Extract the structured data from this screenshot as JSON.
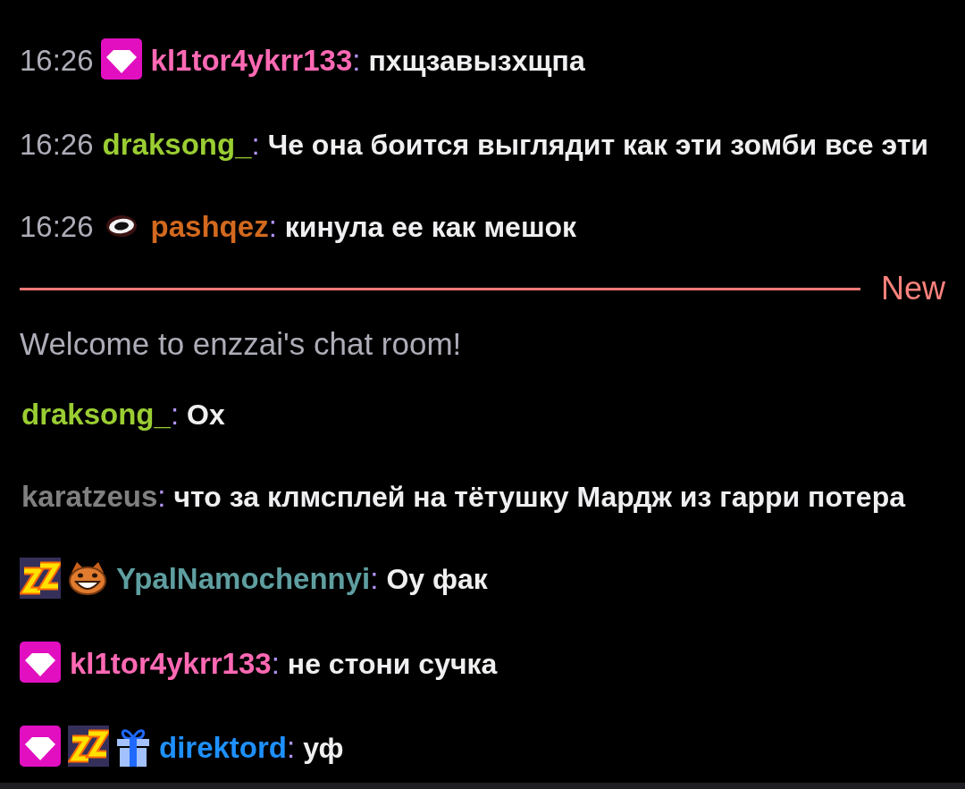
{
  "chat": [
    {
      "kind": "message",
      "timestamp": "16:26",
      "badges": [
        {
          "kind": "gem"
        }
      ],
      "username": "kl1tor4ykrr133",
      "color": "#ff69b4",
      "separator": ":",
      "text": "пхщзавызхщпа"
    },
    {
      "kind": "message",
      "timestamp": "16:26",
      "username": "draksong_",
      "color": "#9acd32",
      "separator": ":",
      "text": "Че она боится выглядит как эти зомби все эти"
    },
    {
      "kind": "message",
      "timestamp": "16:26",
      "badges": [
        {
          "kind": "eye"
        }
      ],
      "username": "pashqez",
      "color": "#d2691e",
      "separator": ":",
      "text": "кинула ее как мешок"
    },
    {
      "kind": "divider",
      "label": "New"
    },
    {
      "kind": "notice",
      "text": "Welcome to enzzai's chat room!"
    },
    {
      "kind": "message",
      "username": "draksong_",
      "color": "#9acd32",
      "separator": ":",
      "text": "Ох"
    },
    {
      "kind": "message",
      "username": "karatzeus",
      "color": "#808080",
      "separator": ":",
      "text": "что за клмсплей на тётушку Мардж из гарри потера"
    },
    {
      "kind": "message",
      "badges": [
        {
          "kind": "zz"
        },
        {
          "kind": "fox"
        }
      ],
      "username": "YpalNamochennyi",
      "color": "#5f9ea0",
      "separator": ":",
      "text": "Оу фак"
    },
    {
      "kind": "message",
      "badges": [
        {
          "kind": "gem"
        }
      ],
      "username": "kl1tor4ykrr133",
      "color": "#ff69b4",
      "separator": ":",
      "text": "не стони сучка"
    },
    {
      "kind": "message",
      "badges": [
        {
          "kind": "gem"
        },
        {
          "kind": "zz"
        },
        {
          "kind": "gift"
        }
      ],
      "username": "direktord",
      "color": "#1e90ff",
      "separator": ":",
      "text": "уф"
    }
  ]
}
